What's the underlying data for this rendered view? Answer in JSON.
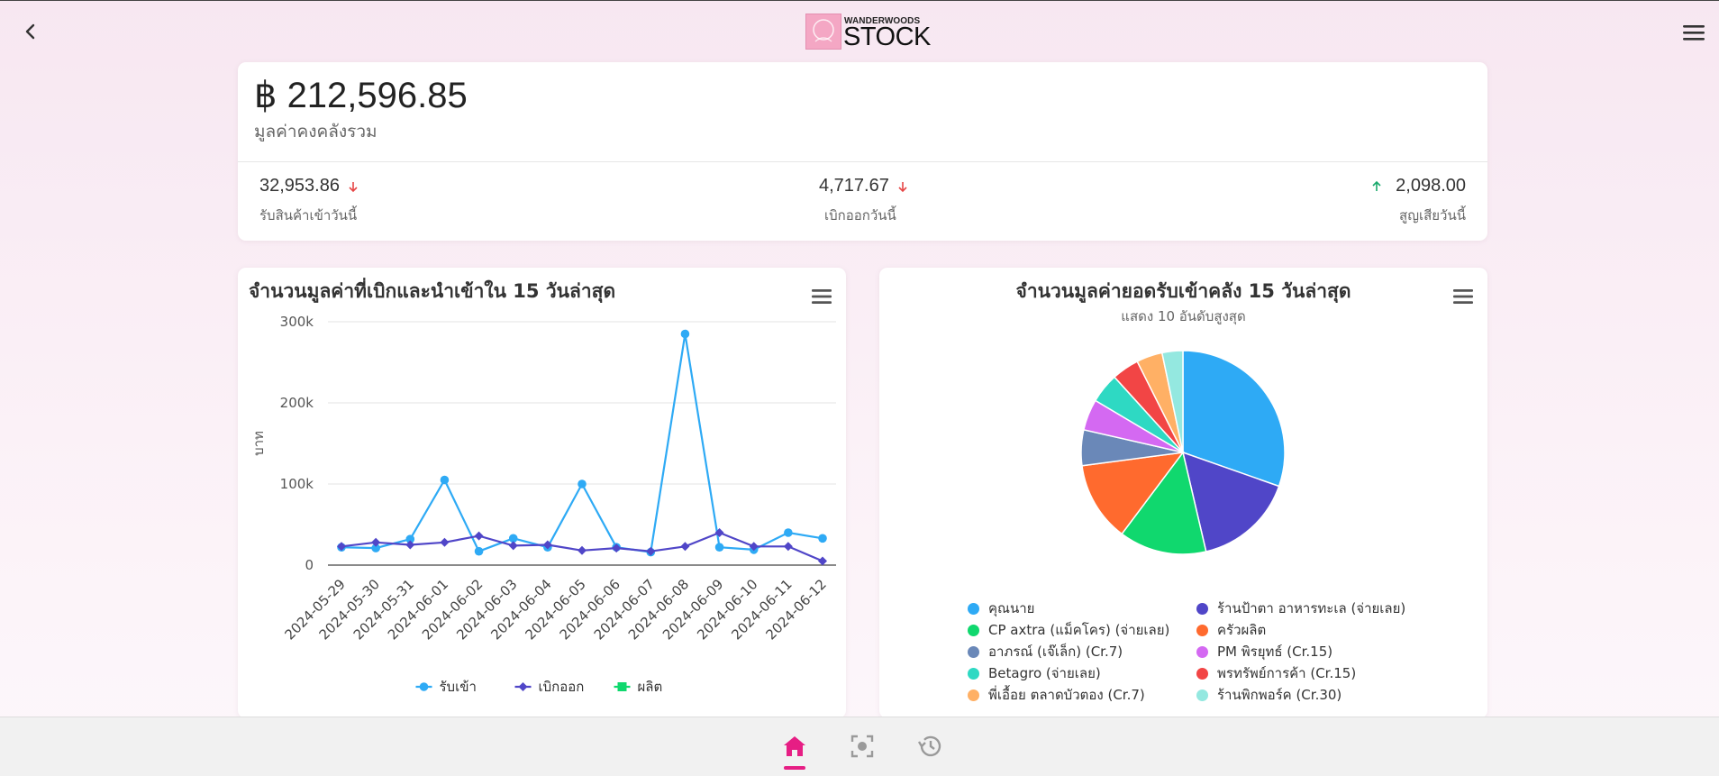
{
  "app": {
    "brand_top": "WANDERWOODS",
    "brand_main": "STOCK"
  },
  "header": {
    "back_icon": "chevron-left-icon",
    "menu_icon": "hamburger-icon"
  },
  "summary": {
    "total_value": "฿ 212,596.85",
    "total_label": "มูลค่าคงคลังรวม",
    "stats": [
      {
        "value": "32,953.86",
        "label": "รับสินค้าเข้าวันนี้",
        "trend": "down",
        "trend_color": "#e64545"
      },
      {
        "value": "4,717.67",
        "label": "เบิกออกวันนี้",
        "trend": "down",
        "trend_color": "#e64545"
      },
      {
        "value": "2,098.00",
        "label": "สูญเสียวันนี้",
        "trend": "up",
        "trend_color": "#18a86b"
      }
    ]
  },
  "line_chart": {
    "title": "จำนวนมูลค่าที่เบิกและนำเข้าใน 15 วันล่าสุด",
    "menu_icon": "hamburger-icon",
    "chart_data": {
      "type": "line",
      "ylabel": "บาท",
      "ylim": [
        0,
        300000
      ],
      "yticks": [
        0,
        100000,
        200000,
        300000
      ],
      "ytick_labels": [
        "0",
        "100k",
        "200k",
        "300k"
      ],
      "categories": [
        "2024-05-29",
        "2024-05-30",
        "2024-05-31",
        "2024-06-01",
        "2024-06-02",
        "2024-06-03",
        "2024-06-04",
        "2024-06-05",
        "2024-06-06",
        "2024-06-07",
        "2024-06-08",
        "2024-06-09",
        "2024-06-10",
        "2024-06-11",
        "2024-06-12"
      ],
      "series": [
        {
          "name": "รับเข้า",
          "color": "#2eaaf5",
          "marker": "circle",
          "values": [
            22000,
            21000,
            32000,
            105000,
            17000,
            33000,
            22000,
            100000,
            22000,
            16000,
            285000,
            22000,
            19000,
            40000,
            33000
          ]
        },
        {
          "name": "เบิกออก",
          "color": "#5046c8",
          "marker": "diamond",
          "values": [
            23000,
            28000,
            25000,
            28000,
            36000,
            24000,
            25000,
            18000,
            21000,
            17000,
            23000,
            40000,
            23000,
            23000,
            5000
          ]
        },
        {
          "name": "ผลิต",
          "color": "#10d86e",
          "marker": "square",
          "values": []
        }
      ],
      "grid": true,
      "legend": "bottom"
    }
  },
  "pie_chart": {
    "title": "จำนวนมูลค่ายอดรับเข้าคลัง 15 วันล่าสุด",
    "subtitle": "แสดง 10 อันดับสูงสุด",
    "menu_icon": "hamburger-icon",
    "chart_data": {
      "type": "pie",
      "legend": "bottom",
      "slices": [
        {
          "label": "คุณนาย",
          "value": 29.5,
          "color": "#2eaaf5"
        },
        {
          "label": "ร้านป้าตา อาหารทะเล (จ่ายเลย)",
          "value": 15.5,
          "color": "#5046c8"
        },
        {
          "label": "CP axtra (แม็คโคร) (จ่ายเลย)",
          "value": 13.5,
          "color": "#10d86e"
        },
        {
          "label": "ครัวผลิต",
          "value": 12.3,
          "color": "#ff6a2e"
        },
        {
          "label": "อาภรณ์ (เจ๊เล็ก) (Cr.7)",
          "value": 5.5,
          "color": "#6a88b8"
        },
        {
          "label": "PM พิรยุทธ์ (Cr.15)",
          "value": 4.8,
          "color": "#d469f2"
        },
        {
          "label": "Betagro (จ่ายเลย)",
          "value": 4.6,
          "color": "#2ed9c3"
        },
        {
          "label": "พรทรัพย์การค้า (Cr.15)",
          "value": 4.2,
          "color": "#f24545"
        },
        {
          "label": "พี่เอื้อย ตลาดบัวตอง (Cr.7)",
          "value": 4.0,
          "color": "#ffb065"
        },
        {
          "label": "ร้านพิกพอร์ค (Cr.30)",
          "value": 3.2,
          "color": "#94e8e0"
        }
      ]
    }
  },
  "bottom_nav": {
    "items": [
      {
        "name": "home",
        "icon": "home-icon",
        "active": true
      },
      {
        "name": "scan",
        "icon": "scan-icon",
        "active": false
      },
      {
        "name": "history",
        "icon": "history-icon",
        "active": false
      }
    ],
    "active_color": "#e61e84",
    "inactive_color": "#9a9a9a"
  }
}
